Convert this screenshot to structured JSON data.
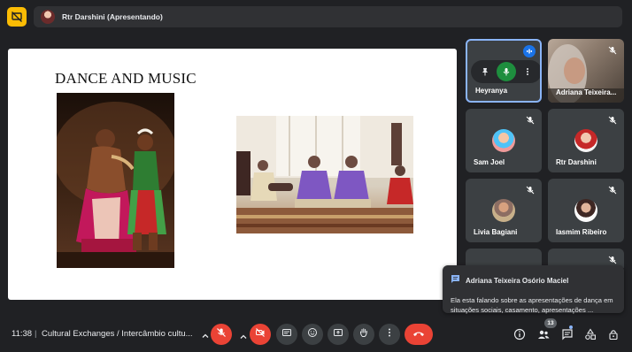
{
  "presenter_bar": {
    "name": "Rtr Darshini (Apresentando)"
  },
  "slide": {
    "title": "DANCE AND MUSIC"
  },
  "participants": [
    {
      "name": "Heyranya"
    },
    {
      "name": "Adriana Teixeira..."
    },
    {
      "name": "Sam Joel"
    },
    {
      "name": "Rtr Darshini"
    },
    {
      "name": "Livia Bagiani"
    },
    {
      "name": "Iasmim Ribeiro"
    }
  ],
  "chat_toast": {
    "sender": "Adriana Teixeira Osório Maciel",
    "message": "Ela esta falando sobre as apresentações de dança em situações sociais, casamento, apresentações ..."
  },
  "bottom_bar": {
    "time": "11:38",
    "separator": "|",
    "meeting_title": "Cultural Exchanges / Intercâmbio cultu...",
    "people_count": "13"
  },
  "colors": {
    "accent_blue": "#8ab4f8",
    "hangup_red": "#ea4335",
    "mic_green": "#1e8e3e",
    "warning_yellow": "#fbbc04"
  },
  "icons": [
    "presentation-off-icon",
    "pin-icon",
    "mic-icon",
    "more-vert-icon",
    "mic-off-icon",
    "chevron-up-icon",
    "videocam-off-icon",
    "captions-icon",
    "emoji-icon",
    "present-icon",
    "raise-hand-icon",
    "call-end-icon",
    "info-icon",
    "people-icon",
    "chat-icon",
    "activities-icon",
    "host-controls-icon",
    "chat-bubble-icon",
    "audio-level-icon"
  ]
}
